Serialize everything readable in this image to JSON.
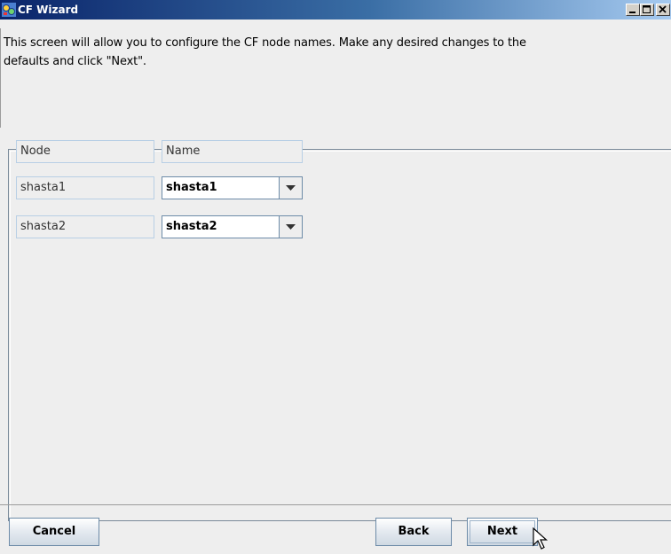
{
  "window": {
    "title": "CF Wizard",
    "app_icon": "cf-app-icon",
    "controls": [
      "minimize-icon",
      "maximize-icon",
      "close-icon"
    ]
  },
  "instructions": {
    "line1": "This screen will allow you to configure the CF node names.  Make any desired changes to the",
    "line2": "defaults and click \"Next\"."
  },
  "table": {
    "headers": {
      "node": "Node",
      "name": "Name"
    },
    "rows": [
      {
        "node": "shasta1",
        "name": "shasta1"
      },
      {
        "node": "shasta2",
        "name": "shasta2"
      }
    ]
  },
  "footer": {
    "cancel_label": "Cancel",
    "back_label": "Back",
    "next_label": "Next"
  },
  "colors": {
    "titlebar_start": "#0a246a",
    "titlebar_end": "#a6caf0",
    "background": "#eeeeee",
    "border": "#6d8ba8"
  }
}
